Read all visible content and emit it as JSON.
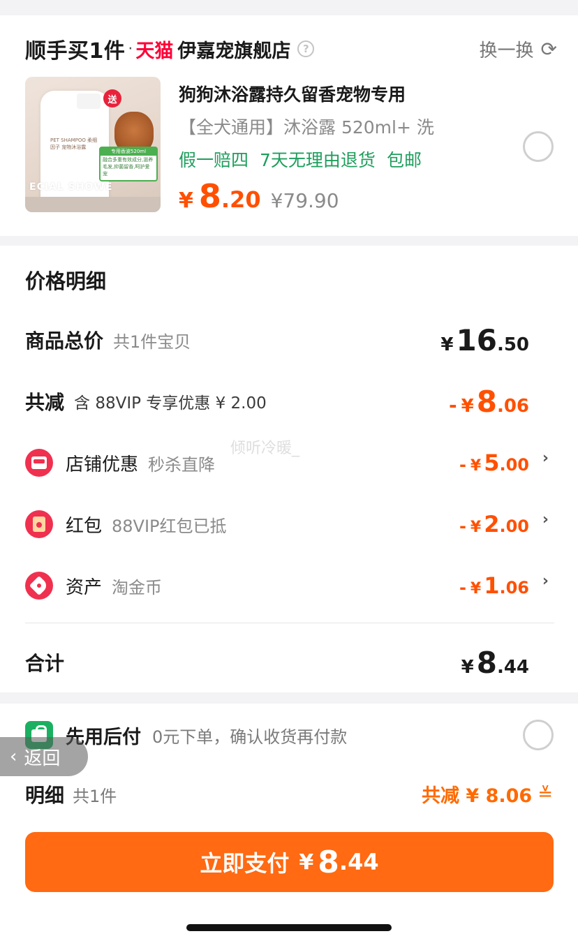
{
  "header": {
    "brand": "顺手买1件",
    "dot": "·",
    "platform": "天猫",
    "store_name": "伊嘉宠旗舰店",
    "help_icon": "?",
    "swap_label": "换一换",
    "refresh_icon": "⟳"
  },
  "product": {
    "title": "狗狗沐浴露持久留香宠物专用",
    "spec": "【全犬通用】沐浴露 520ml+ 洗",
    "tags": [
      "假一赔四",
      "7天无理由退货",
      "包邮"
    ],
    "price_symbol": "¥",
    "price_int": "8",
    "price_dec": ".20",
    "original_price": "¥79.90",
    "image": {
      "gift_badge": "送",
      "bottle_text": "PET SHAMPOO 柔细因子 宠物沐浴露",
      "green_box_head": "专用香波520ml",
      "green_box_text": "融合多重有效成分,滋养毛发,抑菌留香,呵护爱宠",
      "shower_text": "ECIAL SHOWE"
    }
  },
  "price_detail": {
    "section_title": "价格明细",
    "watermark": "倾听冷暖_",
    "total": {
      "label": "商品总价",
      "sub": "共1件宝贝",
      "cur": "¥",
      "int": "16",
      "dec": ".50"
    },
    "discount": {
      "label": "共减",
      "sub": "含 88VIP 专享优惠 ¥ 2.00",
      "sign": "-",
      "cur": "¥",
      "int": "8",
      "dec": ".06"
    },
    "items": [
      {
        "label": "店铺优惠",
        "sub": "秒杀直降",
        "sign": "-",
        "cur": "¥",
        "int": "5",
        "dec": ".00",
        "icon": "shop-icon"
      },
      {
        "label": "红包",
        "sub": "88VIP红包已抵",
        "sign": "-",
        "cur": "¥",
        "int": "2",
        "dec": ".00",
        "icon": "red-packet-icon"
      },
      {
        "label": "资产",
        "sub": "淘金币",
        "sign": "-",
        "cur": "¥",
        "int": "1",
        "dec": ".06",
        "icon": "coin-tag-icon"
      }
    ],
    "chevron": "›",
    "sum": {
      "label": "合计",
      "cur": "¥",
      "int": "8",
      "dec": ".44"
    }
  },
  "payment": {
    "bnpl_label": "先用后付",
    "bnpl_sub": "0元下单，确认收货再付款",
    "back_label": "返回",
    "back_icon": "‹",
    "detail_label": "明细",
    "detail_sub": "共1件",
    "saving_label": "共减 ¥ 8.06",
    "saving_icon": "≚",
    "pay_label": "立即支付",
    "pay_cur": "¥",
    "pay_int": "8",
    "pay_dec": ".44"
  },
  "colors": {
    "accent": "#ff6a12",
    "price": "#ff5000",
    "tag_green": "#1f9e5d",
    "tmall_red": "#ff0036"
  }
}
